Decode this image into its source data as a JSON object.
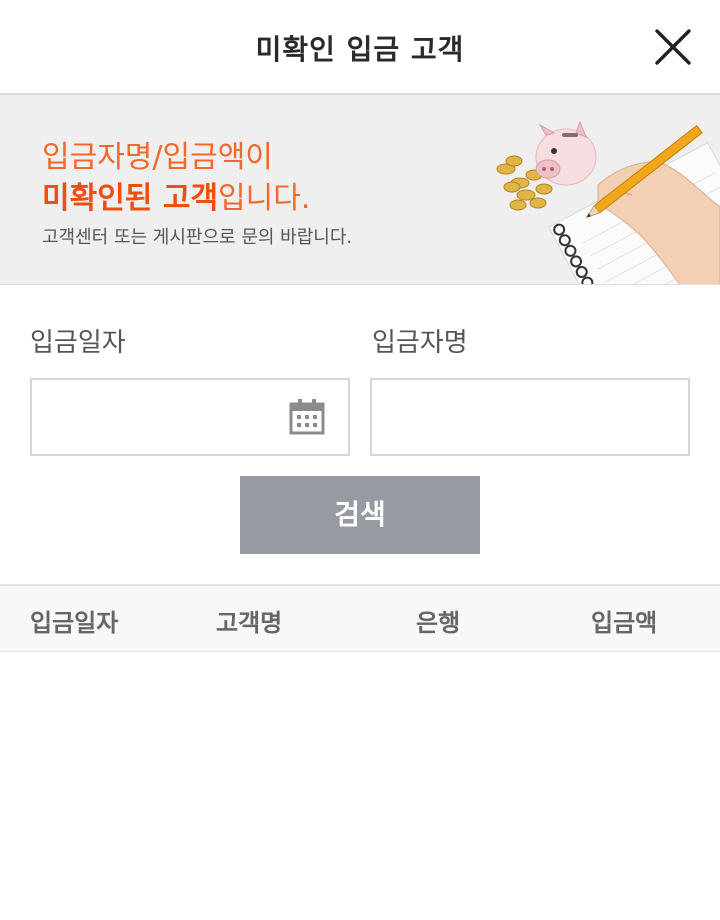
{
  "header": {
    "title": "미확인 입금 고객",
    "close_icon": "close-icon"
  },
  "banner": {
    "line1": "입금자명/입금액이",
    "line2_strong": "미확인된 고객",
    "line2_rest": "입니다.",
    "line3": "고객센터 또는 게시판으로 문의 바랍니다.",
    "illustration": "piggy-bank-coins-notebook-hand-pencil-illustration"
  },
  "form": {
    "date_label": "입금일자",
    "date_value": "",
    "date_placeholder": "",
    "calendar_icon": "calendar-icon",
    "name_label": "입금자명",
    "name_value": "",
    "name_placeholder": "",
    "search_label": "검색"
  },
  "table": {
    "columns": [
      "입금일자",
      "고객명",
      "은행",
      "입금액"
    ],
    "rows": []
  },
  "colors": {
    "accent": "#f2682c",
    "accent_strong": "#ef4e10",
    "button": "#979aa3",
    "banner_bg": "#efefef"
  }
}
